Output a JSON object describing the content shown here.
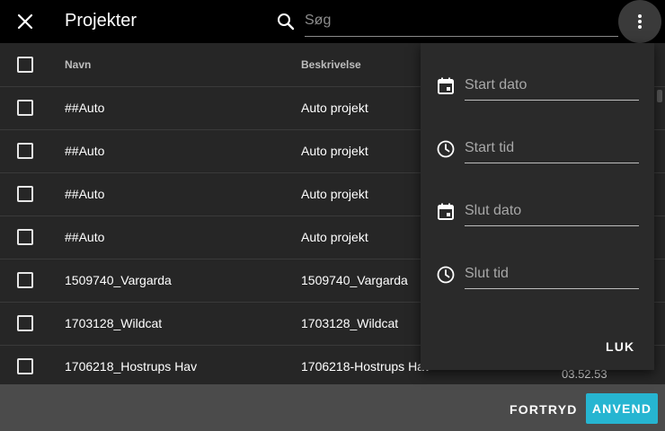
{
  "header": {
    "title": "Projekter",
    "search_placeholder": "Søg"
  },
  "table": {
    "columns": [
      "Navn",
      "Beskrivelse"
    ],
    "rows": [
      {
        "name": "##Auto",
        "description": "Auto projekt"
      },
      {
        "name": "##Auto",
        "description": "Auto projekt"
      },
      {
        "name": "##Auto",
        "description": "Auto projekt"
      },
      {
        "name": "##Auto",
        "description": "Auto projekt"
      },
      {
        "name": "1509740_Vargarda",
        "description": "1509740_Vargarda"
      },
      {
        "name": "1703128_Wildcat",
        "description": "1703128_Wildcat"
      },
      {
        "name": "1706218_Hostrups Hav",
        "description": "1706218-Hostrups Hav"
      }
    ],
    "partial_time": "03.52.53"
  },
  "filter_panel": {
    "start_date_placeholder": "Start dato",
    "start_time_placeholder": "Start tid",
    "end_date_placeholder": "Slut dato",
    "end_time_placeholder": "Slut tid",
    "close_label": "LUK"
  },
  "footer": {
    "cancel_label": "FORTRYD",
    "apply_label": "ANVEND"
  },
  "colors": {
    "accent": "#26b5d1",
    "topbar": "#000000",
    "table_bg": "#262626",
    "panel_bg": "#2a2a2a"
  }
}
